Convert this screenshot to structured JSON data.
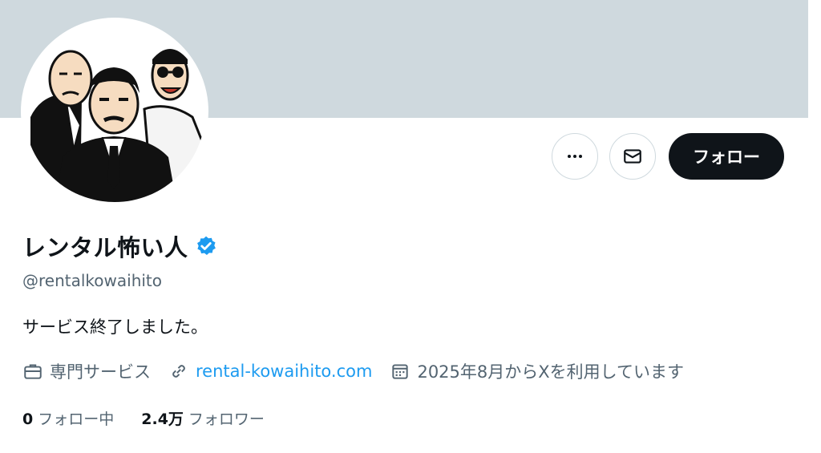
{
  "profile": {
    "display_name": "レンタル怖い人",
    "handle": "@rentalkowaihito",
    "bio": "サービス終了しました。",
    "category": "専門サービス",
    "website": "rental-kowaihito.com",
    "joined": "2025年8月からXを利用しています",
    "verified_icon": "verified-badge-icon"
  },
  "actions": {
    "more_icon": "more-icon",
    "message_icon": "mail-icon",
    "follow_label": "フォロー"
  },
  "stats": {
    "following_count": "0",
    "following_label": "フォロー中",
    "followers_count": "2.4万",
    "followers_label": "フォロワー"
  },
  "colors": {
    "banner": "#cfd9de",
    "accent_link": "#1d9bf0",
    "verified": "#1d9bf0",
    "follow_button": "#0f1419"
  }
}
